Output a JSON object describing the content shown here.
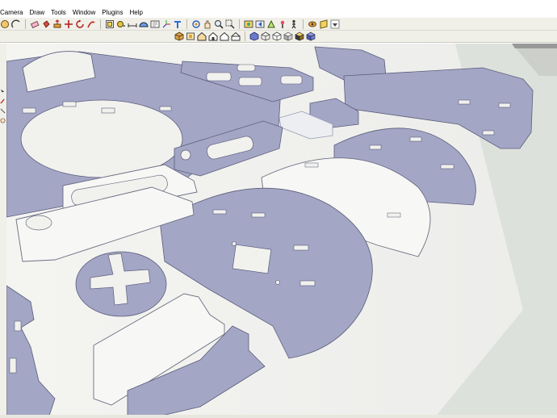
{
  "menu": {
    "items": [
      {
        "id": "camera",
        "label": "Camera"
      },
      {
        "id": "draw",
        "label": "Draw"
      },
      {
        "id": "tools",
        "label": "Tools"
      },
      {
        "id": "window",
        "label": "Window"
      },
      {
        "id": "plugins",
        "label": "Plugins"
      },
      {
        "id": "help",
        "label": "Help"
      }
    ]
  },
  "toolbar_top": {
    "icons": [
      "circle-icon",
      "arc-icon",
      "eraser-icon",
      "paint-bucket-icon",
      "push-pull-icon",
      "move-icon",
      "rotate-icon",
      "follow-me-icon",
      "offset-icon",
      "tape-measure-icon",
      "dimension-icon",
      "protractor-icon",
      "text-icon",
      "axes-icon",
      "3d-text-icon",
      "orbit-icon",
      "pan-icon",
      "zoom-icon",
      "zoom-window-icon",
      "zoom-extents-icon",
      "previous-view-icon",
      "next-view-icon",
      "position-camera-icon",
      "walk-icon",
      "look-around-icon",
      "section-plane-icon"
    ]
  },
  "toolbar_views": {
    "icons": [
      "iso-view-icon",
      "top-view-icon",
      "front-view-icon",
      "right-view-icon",
      "back-view-icon",
      "left-view-icon",
      "xray-icon",
      "wireframe-icon",
      "hidden-line-icon",
      "shaded-icon",
      "shaded-textures-icon",
      "monochrome-icon"
    ]
  },
  "colors": {
    "part_fill": "#a4a6c6",
    "part_dark": "#8a8cb0",
    "ground": "#f1f1ee",
    "ground_right": "#dfe2de",
    "toolbar_bg": "#f0efe8"
  }
}
